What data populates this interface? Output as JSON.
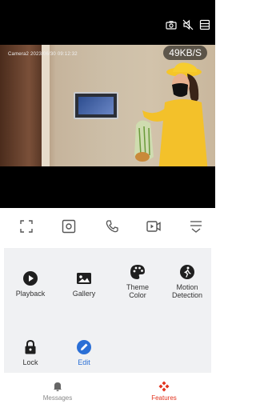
{
  "video": {
    "timestamp": "Camera2 2023/06/30   09:12:32",
    "bitrate": "49KB/S",
    "top_icons": [
      "camera-icon",
      "mute-speaker-icon",
      "layout-icon"
    ]
  },
  "controls": [
    "fullscreen-icon",
    "snapshot-icon",
    "phone-icon",
    "record-icon",
    "more-menu-icon"
  ],
  "features": [
    {
      "label": "Playback",
      "icon": "play-circle-icon"
    },
    {
      "label": "Gallery",
      "icon": "image-icon"
    },
    {
      "label": "Theme Color",
      "icon": "palette-icon"
    },
    {
      "label": "Motion Detection",
      "icon": "walking-person-icon"
    },
    {
      "label": "Lock",
      "icon": "lock-icon"
    },
    {
      "label": "Edit",
      "icon": "pencil-circle-icon"
    }
  ],
  "tabs": {
    "messages": "Messages",
    "features": "Features",
    "active": "features"
  },
  "colors": {
    "accent": "#e2331d",
    "edit_blue": "#2a6fd6",
    "panel_bg": "#f0f1f3"
  }
}
